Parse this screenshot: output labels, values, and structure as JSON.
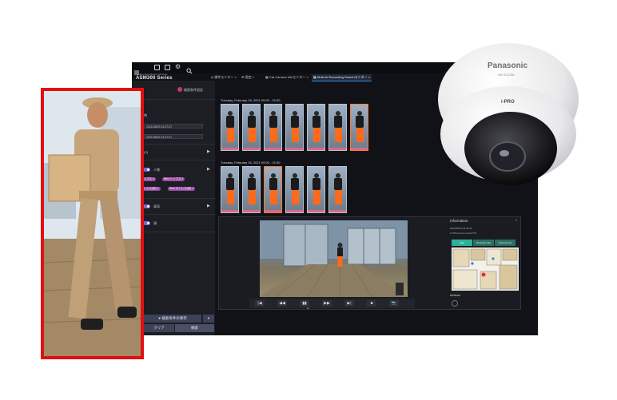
{
  "topbar": {
    "menu_icon": "hamburger-menu-icon",
    "icons": [
      "monitor-icon",
      "layout-icon",
      "gear-icon",
      "search-icon"
    ]
  },
  "brand": {
    "small": "Video Surveillance Software",
    "title": "ASM300 Series"
  },
  "tabs": [
    {
      "label": "Q 操作モニター",
      "close": "×",
      "active": false
    },
    {
      "label": "⚙ 設定",
      "close": "×",
      "active": false
    },
    {
      "label": "▦ Cat Camera Infoモニター",
      "close": "×",
      "active": false
    },
    {
      "label": "▦ Multi-AI Recording Searchモニター",
      "close": "×",
      "active": true
    }
  ],
  "left_panel": {
    "header_action": "検索条件設定",
    "section_time": "時",
    "time_from": "2021/08/29  13:27:07",
    "time_to": "2021/08/29  13:27:07",
    "camera_label": "ラ (2)",
    "person_label": "人物",
    "tags": [
      "トップス ×",
      "Red トップス ×",
      "ボトムス(赤) ×",
      "Red ボトムス(赤) ×"
    ],
    "vehicle_label": "車両",
    "other_label": "顔",
    "save_button": "検索条件の保存",
    "clear_button": "クリア",
    "search_button": "検索"
  },
  "results": {
    "group1_date": "Tuesday, February 16, 2021 09:00 - 21:00",
    "group2_date": "Tuesday, February 16, 2021 09:00 - 21:00",
    "group1_count": 7,
    "group2_count": 6
  },
  "player": {
    "controls": [
      "|◀",
      "◀◀",
      "▮▮",
      "▶▶",
      "▶|",
      "■",
      "📷"
    ],
    "speed": "1x"
  },
  "info": {
    "title": "Information",
    "line1": "2021/08/29 18:48:16",
    "line2": "11:58 Camera (Area)776",
    "tabs": [
      "Map",
      "Detected Info",
      "Camera Info"
    ],
    "actions_label": "Actions"
  },
  "camera": {
    "brand": "Panasonic",
    "model": "WV-S2136L",
    "badge": "i-PRO"
  }
}
